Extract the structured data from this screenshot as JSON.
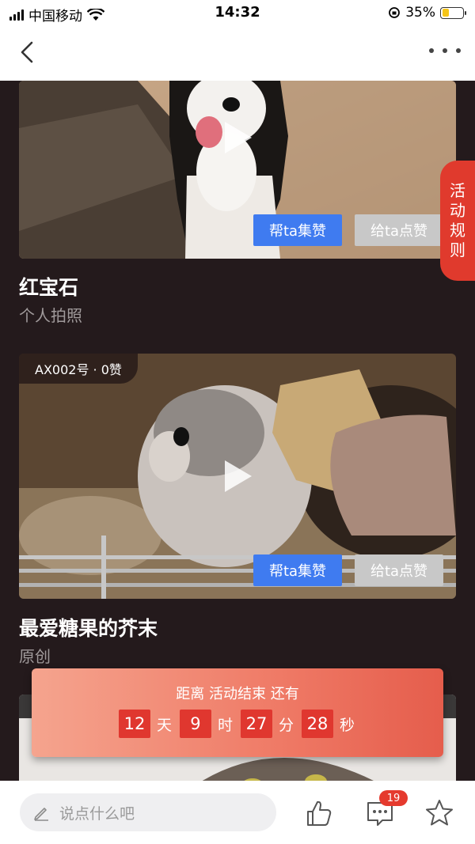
{
  "status_bar": {
    "carrier": "中国移动",
    "time": "14:32",
    "battery": "35%",
    "battery_level": 0.35
  },
  "nav": {
    "back_icon": "chevron-left-icon",
    "more_icon": "more-horizontal-icon"
  },
  "rules_tab": {
    "label": [
      "活",
      "动",
      "规",
      "则"
    ]
  },
  "cards": [
    {
      "title": "红宝石",
      "subtitle": "个人拍照",
      "vote_label": "帮ta集赞",
      "like_label": "给ta点赞"
    },
    {
      "badge": "AX002号 · 0赞",
      "title": "最爱糖果的芥末",
      "subtitle": "原创",
      "vote_label": "帮ta集赞",
      "like_label": "给ta点赞"
    }
  ],
  "countdown": {
    "title": "距离 活动结束 还有",
    "days": "12",
    "days_unit": "天",
    "hours": "9",
    "hours_unit": "时",
    "minutes": "27",
    "minutes_unit": "分",
    "seconds": "28",
    "seconds_unit": "秒"
  },
  "bottom_bar": {
    "comment_placeholder": "说点什么吧",
    "comment_count": "19",
    "icons": [
      "pencil-icon",
      "thumbs-up-icon",
      "comment-icon",
      "star-icon"
    ]
  },
  "colors": {
    "accent_red": "#e03a2d",
    "button_blue": "#3f7bf0",
    "background": "#241a1c"
  }
}
